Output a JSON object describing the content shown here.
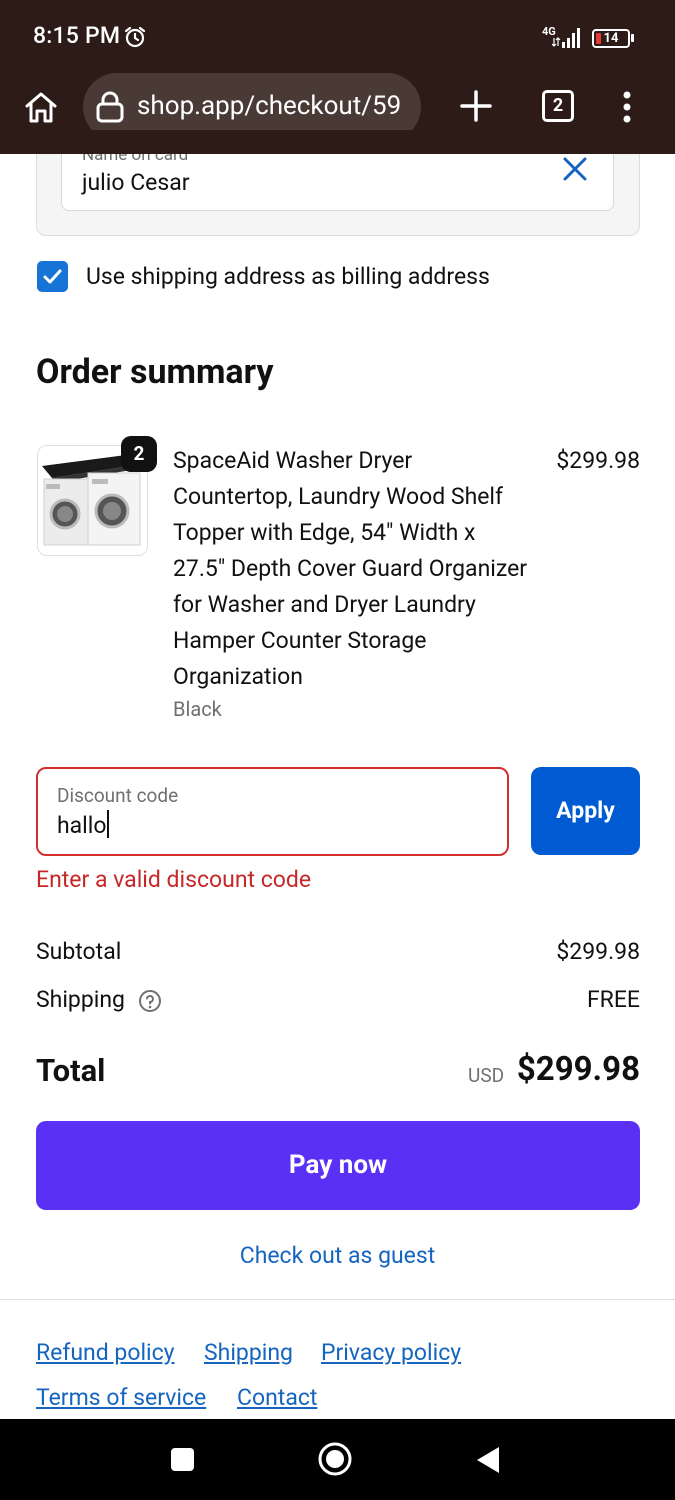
{
  "status_bar": {
    "time": "8:15 PM",
    "network": "4G",
    "battery": "14",
    "icons": [
      "alarm-icon",
      "signal-icon",
      "battery-icon"
    ]
  },
  "browser": {
    "url": "shop.app/checkout/59",
    "tab_count": "2",
    "icons": [
      "home-icon",
      "lock-icon",
      "plus-icon",
      "tabs-icon",
      "menu-icon"
    ]
  },
  "payment": {
    "name_label": "Name on card",
    "name_value": "julio Cesar",
    "billing_checkbox_label": "Use shipping address as billing address",
    "billing_checked": true
  },
  "order_summary": {
    "title": "Order summary",
    "item": {
      "quantity": "2",
      "name": "SpaceAid Washer Dryer Countertop, Laundry Wood Shelf Topper with Edge, 54\" Width x 27.5\" Depth Cover Guard Organizer for Washer and Dryer Laundry Hamper Counter Storage Organization",
      "variant": "Black",
      "price": "$299.98"
    }
  },
  "discount": {
    "label": "Discount code",
    "value": "hallo",
    "apply_label": "Apply",
    "error": "Enter a valid discount code"
  },
  "totals": {
    "subtotal_label": "Subtotal",
    "subtotal_value": "$299.98",
    "shipping_label": "Shipping",
    "shipping_value": "FREE",
    "total_label": "Total",
    "currency": "USD",
    "total_value": "$299.98"
  },
  "actions": {
    "pay_label": "Pay now",
    "guest_label": "Check out as guest"
  },
  "footer": {
    "links": [
      "Refund policy",
      "Shipping",
      "Privacy policy",
      "Terms of service",
      "Contact"
    ]
  },
  "colors": {
    "browser_chrome": "#2c1b17",
    "pay_button": "#5a31f4",
    "apply_button": "#005bd3",
    "link": "#1565c0",
    "error": "#c62828",
    "checkbox": "#1773d6"
  }
}
